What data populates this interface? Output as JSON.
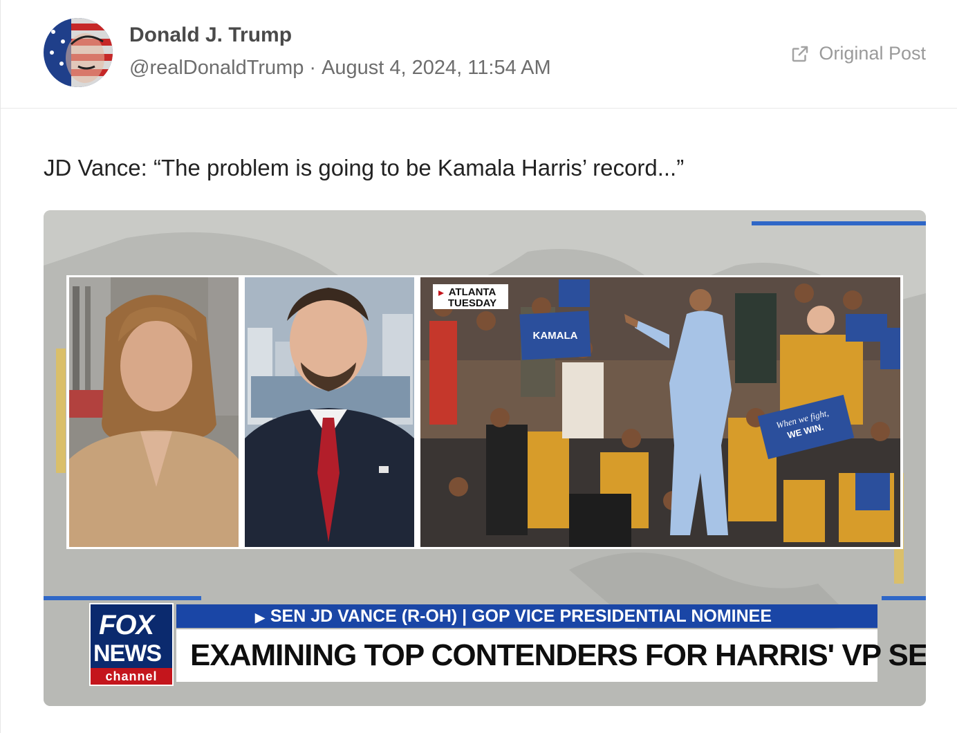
{
  "post": {
    "author": {
      "name": "Donald J. Trump",
      "handle": "@realDonaldTrump",
      "separator": "·",
      "timestamp": "August 4, 2024, 11:54 AM"
    },
    "original_post_label": "Original Post",
    "text": "JD Vance: “The problem is going to be Kamala Harris’ record...”",
    "media": {
      "lower_third": {
        "logo_top": "FOX",
        "logo_bottom": "NEWS",
        "logo_channel": "channel",
        "subtitle": "SEN JD VANCE (R-OH) | GOP VICE PRESIDENTIAL NOMINEE",
        "headline": "EXAMINING TOP CONTENDERS FOR HARRIS' VP SELECTION"
      },
      "panel_tag": {
        "line1": "ATLANTA",
        "line2": "TUESDAY"
      },
      "signs": [
        "KAMALA",
        "When we fight,",
        "WE WIN."
      ]
    },
    "colors": {
      "fox_blue": "#1a46a6",
      "fox_navy": "#0b2a6e",
      "fox_red": "#c4151c",
      "sign_blue": "#2b4f9c"
    },
    "icons": [
      "external-link-icon",
      "play-triangle-icon"
    ]
  }
}
